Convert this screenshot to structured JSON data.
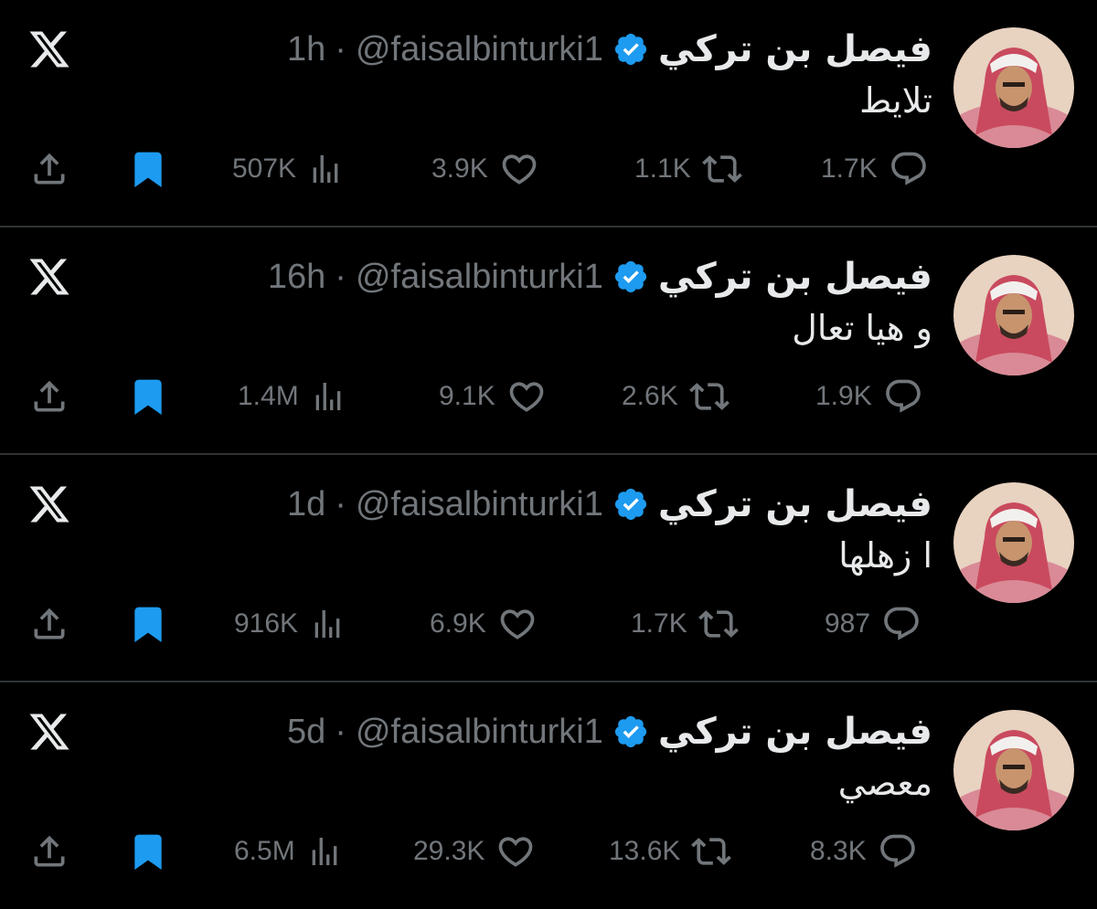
{
  "colors": {
    "background": "#000000",
    "text": "#e7e9ea",
    "muted": "#71767b",
    "accent": "#1d9bf0",
    "divider": "#2f3336"
  },
  "icons": [
    "x-logo-icon",
    "verified-badge-icon",
    "share-icon",
    "bookmark-icon",
    "views-icon",
    "like-icon",
    "retweet-icon",
    "reply-icon"
  ],
  "tweets": [
    {
      "name": "فيصل بن تركي",
      "handle": "@faisalbinturki1",
      "time": "1h",
      "separator": "·",
      "text": "تلايط",
      "views": "507K",
      "likes": "3.9K",
      "retweets": "1.1K",
      "replies": "1.7K"
    },
    {
      "name": "فيصل بن تركي",
      "handle": "@faisalbinturki1",
      "time": "16h",
      "separator": "·",
      "text": "و هيا تعال",
      "views": "1.4M",
      "likes": "9.1K",
      "retweets": "2.6K",
      "replies": "1.9K"
    },
    {
      "name": "فيصل بن تركي",
      "handle": "@faisalbinturki1",
      "time": "1d",
      "separator": "·",
      "text": "ا زهلها",
      "views": "916K",
      "likes": "6.9K",
      "retweets": "1.7K",
      "replies": "987"
    },
    {
      "name": "فيصل بن تركي",
      "handle": "@faisalbinturki1",
      "time": "5d",
      "separator": "·",
      "text": "معصي",
      "views": "6.5M",
      "likes": "29.3K",
      "retweets": "13.6K",
      "replies": "8.3K"
    }
  ]
}
